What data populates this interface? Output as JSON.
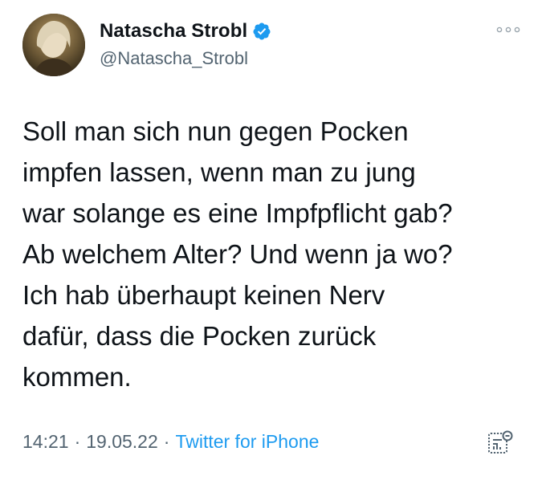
{
  "user": {
    "display_name": "Natascha Strobl",
    "handle": "@Natascha_Strobl",
    "verified_icon": "verified-badge-icon"
  },
  "tweet": {
    "text": "Soll man sich nun gegen Pocken\nimpfen lassen, wenn man zu jung\nwar solange es eine Impfpflicht gab?\nAb welchem Alter? Und wenn ja wo?\nIch hab überhaupt keinen Nerv\ndafür, dass die Pocken zurück\nkommen.",
    "time": "14:21",
    "date": "19.05.22",
    "separator": "·",
    "source": "Twitter for iPhone"
  },
  "icons": {
    "more": "more-options-icon",
    "analytics": "tweet-analytics-icon"
  },
  "colors": {
    "text_primary": "#0f1419",
    "text_secondary": "#536471",
    "accent": "#1d9bf0"
  }
}
